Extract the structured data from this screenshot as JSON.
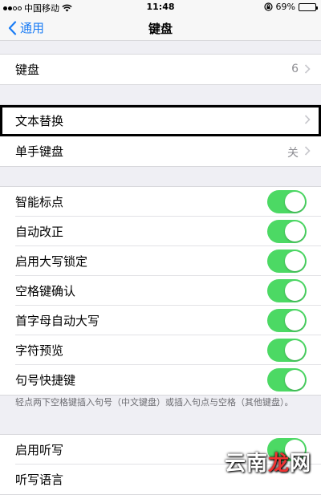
{
  "status_bar": {
    "carrier": "中国移动",
    "time": "11:48",
    "battery": "69%",
    "battery_level": 0.69,
    "icons": [
      "signal-dots-icon",
      "wifi-icon",
      "rotation-lock-icon",
      "battery-icon"
    ]
  },
  "nav": {
    "back_label": "通用",
    "title": "键盘"
  },
  "section1": {
    "keyboards_label": "键盘",
    "keyboards_value": "6"
  },
  "section2": {
    "text_replacement_label": "文本替换",
    "one_handed_label": "单手键盘",
    "one_handed_value": "关"
  },
  "toggles": [
    {
      "label": "智能标点",
      "on": true
    },
    {
      "label": "自动改正",
      "on": true
    },
    {
      "label": "启用大写锁定",
      "on": true
    },
    {
      "label": "空格键确认",
      "on": true
    },
    {
      "label": "首字母自动大写",
      "on": true
    },
    {
      "label": "字符预览",
      "on": true
    },
    {
      "label": "句号快捷键",
      "on": true
    }
  ],
  "footnote": "轻点两下空格键插入句号（中文键盘）或插入句点与空格（其他键盘）。",
  "section4": {
    "dictation_label": "启用听写",
    "dictation_on": true,
    "dictation_language_label": "听写语言"
  },
  "watermark": {
    "part1": "云南",
    "part2": "龙",
    "part3": "网"
  },
  "colors": {
    "accent": "#1a7cf5",
    "toggle_on": "#4cd964",
    "background": "#efeff4"
  }
}
